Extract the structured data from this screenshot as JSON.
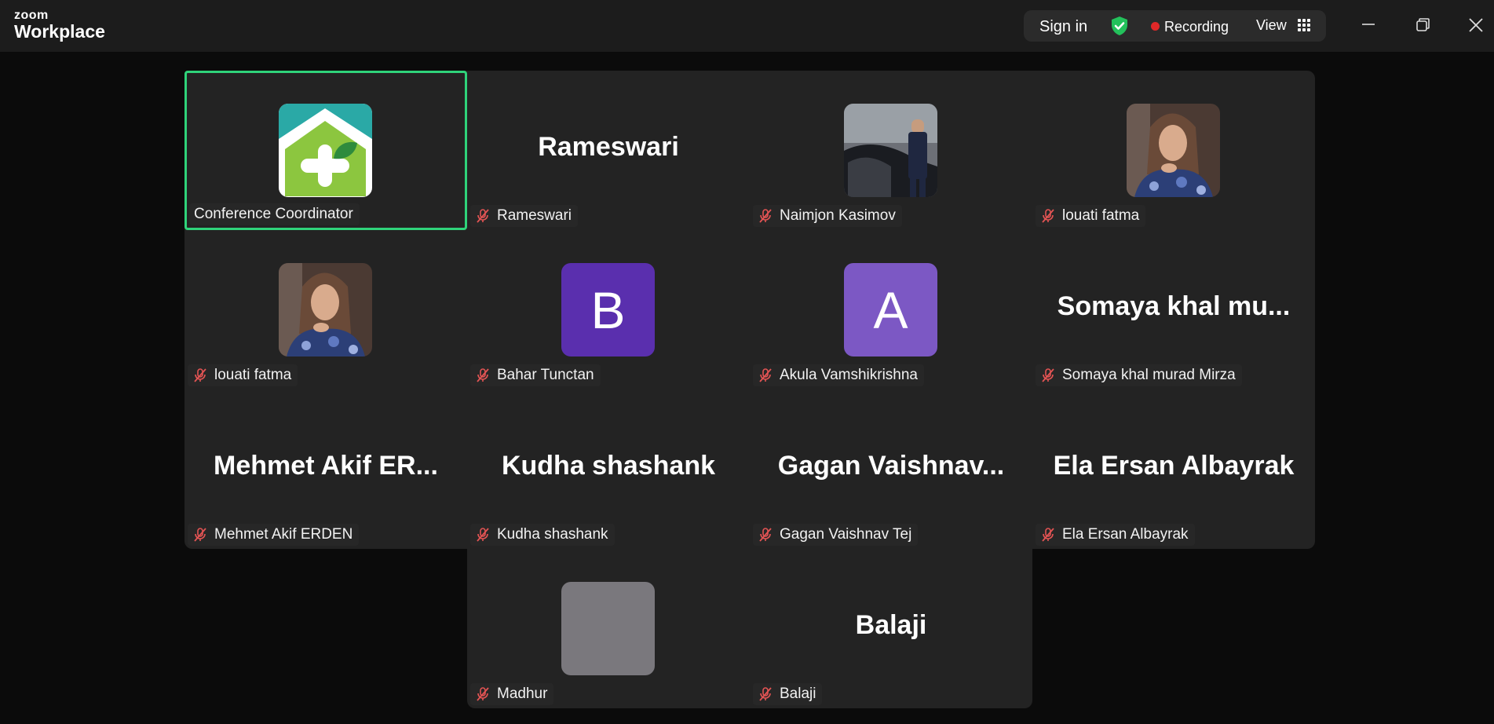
{
  "app": {
    "logo_top": "zoom",
    "logo_main": "Workplace"
  },
  "topbar": {
    "sign_in": "Sign in",
    "recording": "Recording",
    "view": "View",
    "shield_color": "#23c15b",
    "recording_color": "#e02828"
  },
  "window_controls": [
    "minimize-icon",
    "restore-icon",
    "close-icon"
  ],
  "accent_active_border": "#2fd37a",
  "participants": [
    {
      "name": "Conference Coordinator",
      "display": "logo",
      "muted": false,
      "active": true
    },
    {
      "name": "Rameswari",
      "display": "text",
      "big_label": "Rameswari",
      "muted": true
    },
    {
      "name": "Naimjon Kasimov",
      "display": "photo",
      "muted": true
    },
    {
      "name": "louati fatma",
      "display": "photo",
      "muted": true
    },
    {
      "name": "louati fatma",
      "display": "photo",
      "muted": true
    },
    {
      "name": "Bahar Tunctan",
      "display": "letter",
      "letter": "B",
      "avatar_color": "#5a2fae",
      "muted": true
    },
    {
      "name": "Akula Vamshikrishna",
      "display": "letter",
      "letter": "A",
      "avatar_color": "#7c58c4",
      "muted": true
    },
    {
      "name": "Somaya khal murad Mirza",
      "display": "text",
      "big_label": "Somaya khal mu...",
      "muted": true
    },
    {
      "name": "Mehmet Akif ERDEN",
      "display": "text",
      "big_label": "Mehmet Akif ER...",
      "muted": true
    },
    {
      "name": "Kudha shashank",
      "display": "text",
      "big_label": "Kudha shashank",
      "muted": true
    },
    {
      "name": "Gagan Vaishnav Tej",
      "display": "text",
      "big_label": "Gagan Vaishnav...",
      "muted": true
    },
    {
      "name": "Ela Ersan Albayrak",
      "display": "text",
      "big_label": "Ela Ersan Albayrak",
      "muted": true
    },
    {
      "name": "Madhur",
      "display": "blank",
      "avatar_color": "#7a787d",
      "muted": true
    },
    {
      "name": "Balaji",
      "display": "text",
      "big_label": "Balaji",
      "muted": true
    }
  ]
}
